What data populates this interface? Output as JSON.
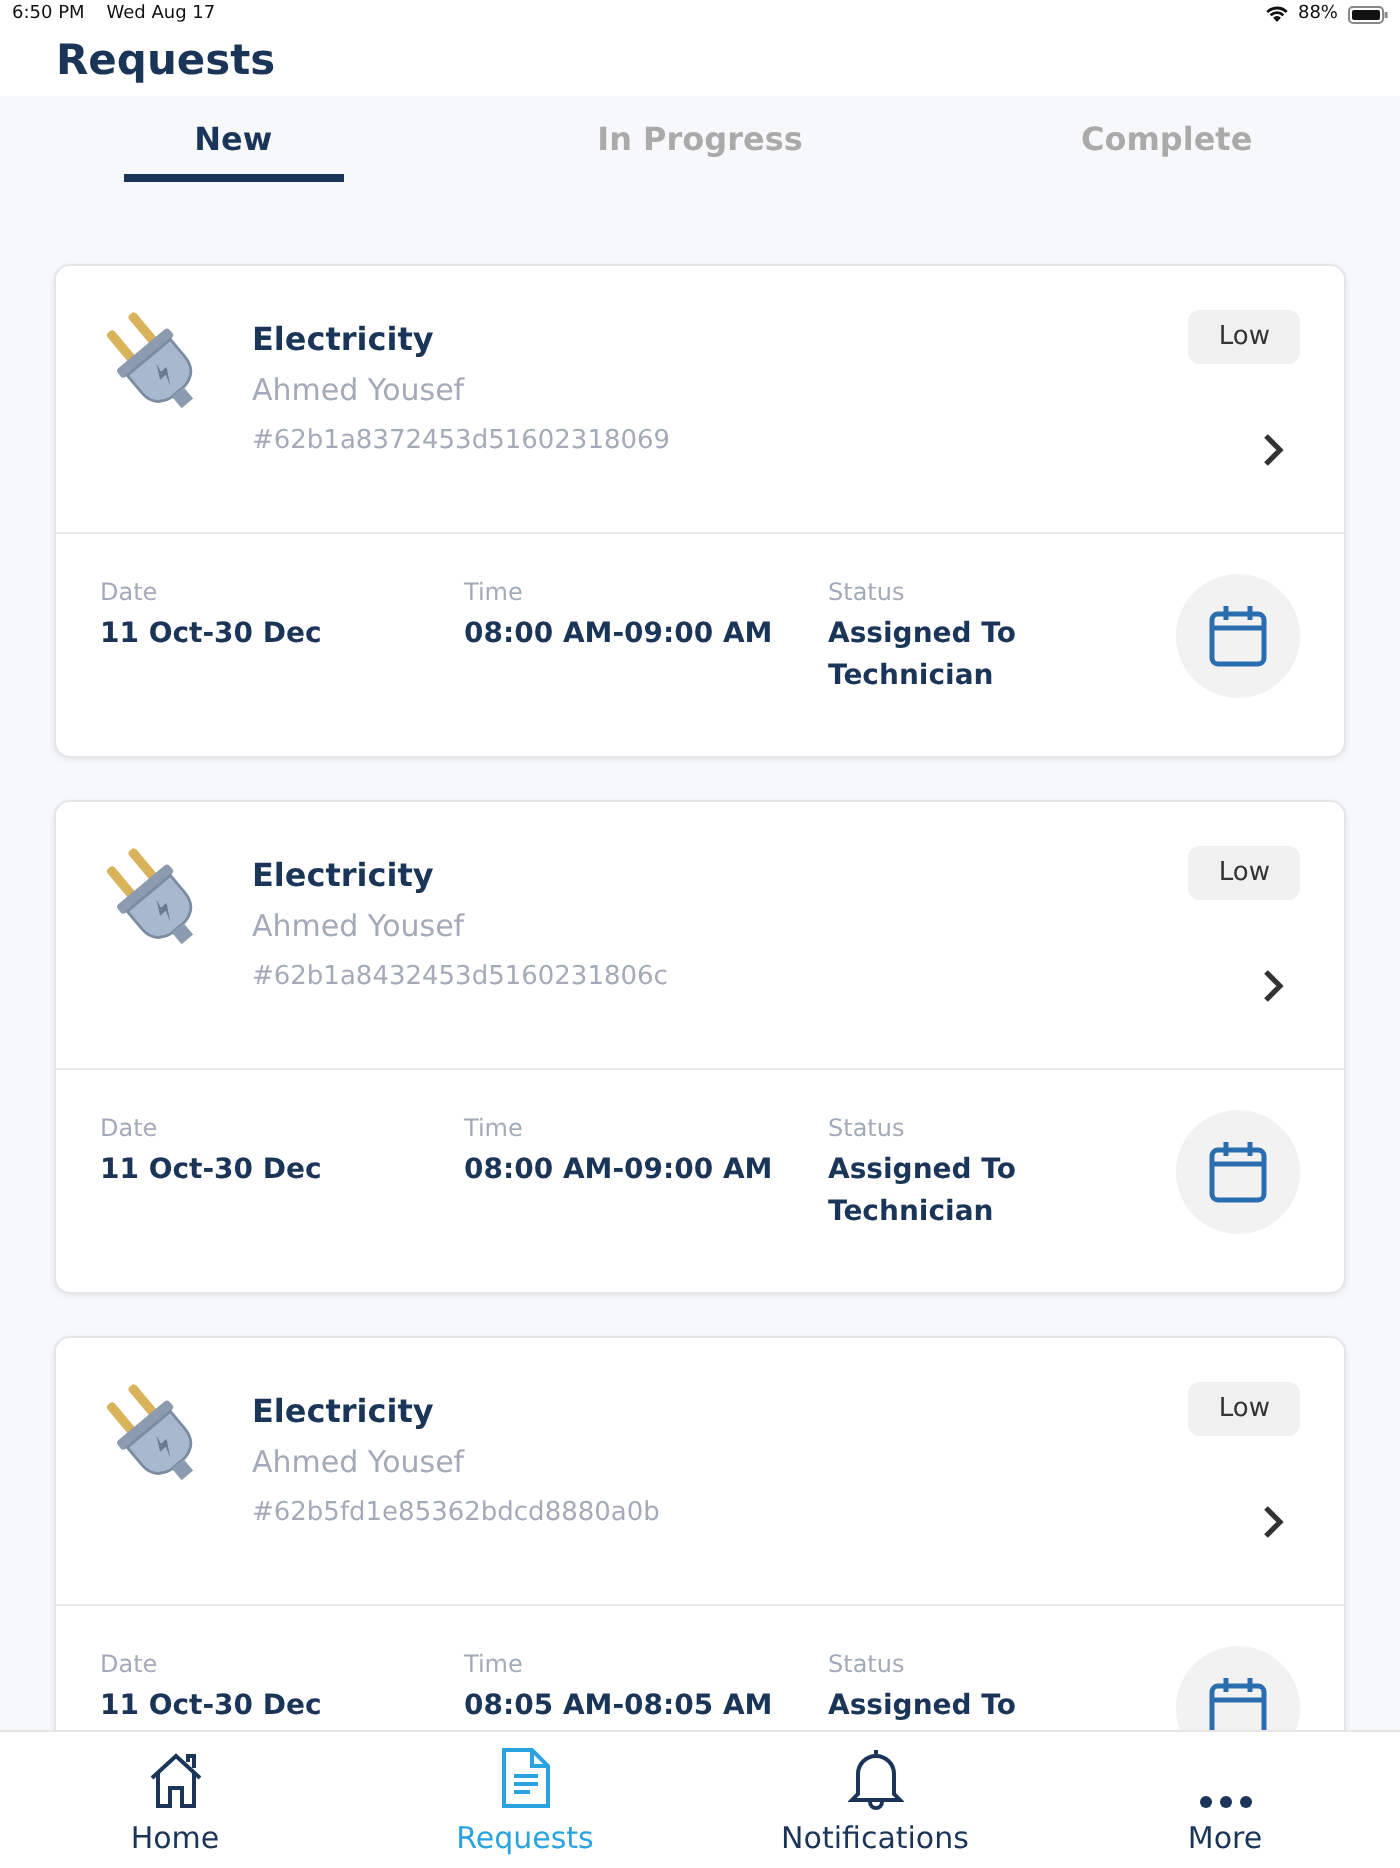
{
  "status_bar": {
    "time": "6:50 PM",
    "date": "Wed Aug 17",
    "battery": "88%"
  },
  "title": "Requests",
  "tabs": [
    {
      "label": "New",
      "selected": true
    },
    {
      "label": "In Progress",
      "selected": false
    },
    {
      "label": "Complete",
      "selected": false
    }
  ],
  "requests": [
    {
      "category": "Electricity",
      "name": "Ahmed Yousef",
      "id": "#62b1a8372453d51602318069",
      "priority": "Low",
      "date_label": "Date",
      "date": "11 Oct-30 Dec",
      "time_label": "Time",
      "time": "08:00 AM-09:00 AM",
      "status_label": "Status",
      "status": "Assigned To Technician"
    },
    {
      "category": "Electricity",
      "name": "Ahmed Yousef",
      "id": "#62b1a8432453d5160231806c",
      "priority": "Low",
      "date_label": "Date",
      "date": "11 Oct-30 Dec",
      "time_label": "Time",
      "time": "08:00 AM-09:00 AM",
      "status_label": "Status",
      "status": "Assigned To Technician"
    },
    {
      "category": "Electricity",
      "name": "Ahmed Yousef",
      "id": "#62b5fd1e85362bdcd8880a0b",
      "priority": "Low",
      "date_label": "Date",
      "date": "11 Oct-30 Dec",
      "time_label": "Time",
      "time": "08:05 AM-08:05 AM",
      "status_label": "Status",
      "status": "Assigned To"
    }
  ],
  "nav": [
    {
      "kind": "home",
      "label": "Home",
      "selected": false
    },
    {
      "kind": "requests",
      "label": "Requests",
      "selected": true
    },
    {
      "kind": "notifications",
      "label": "Notifications",
      "selected": false
    },
    {
      "kind": "more",
      "label": "More",
      "selected": false
    }
  ]
}
